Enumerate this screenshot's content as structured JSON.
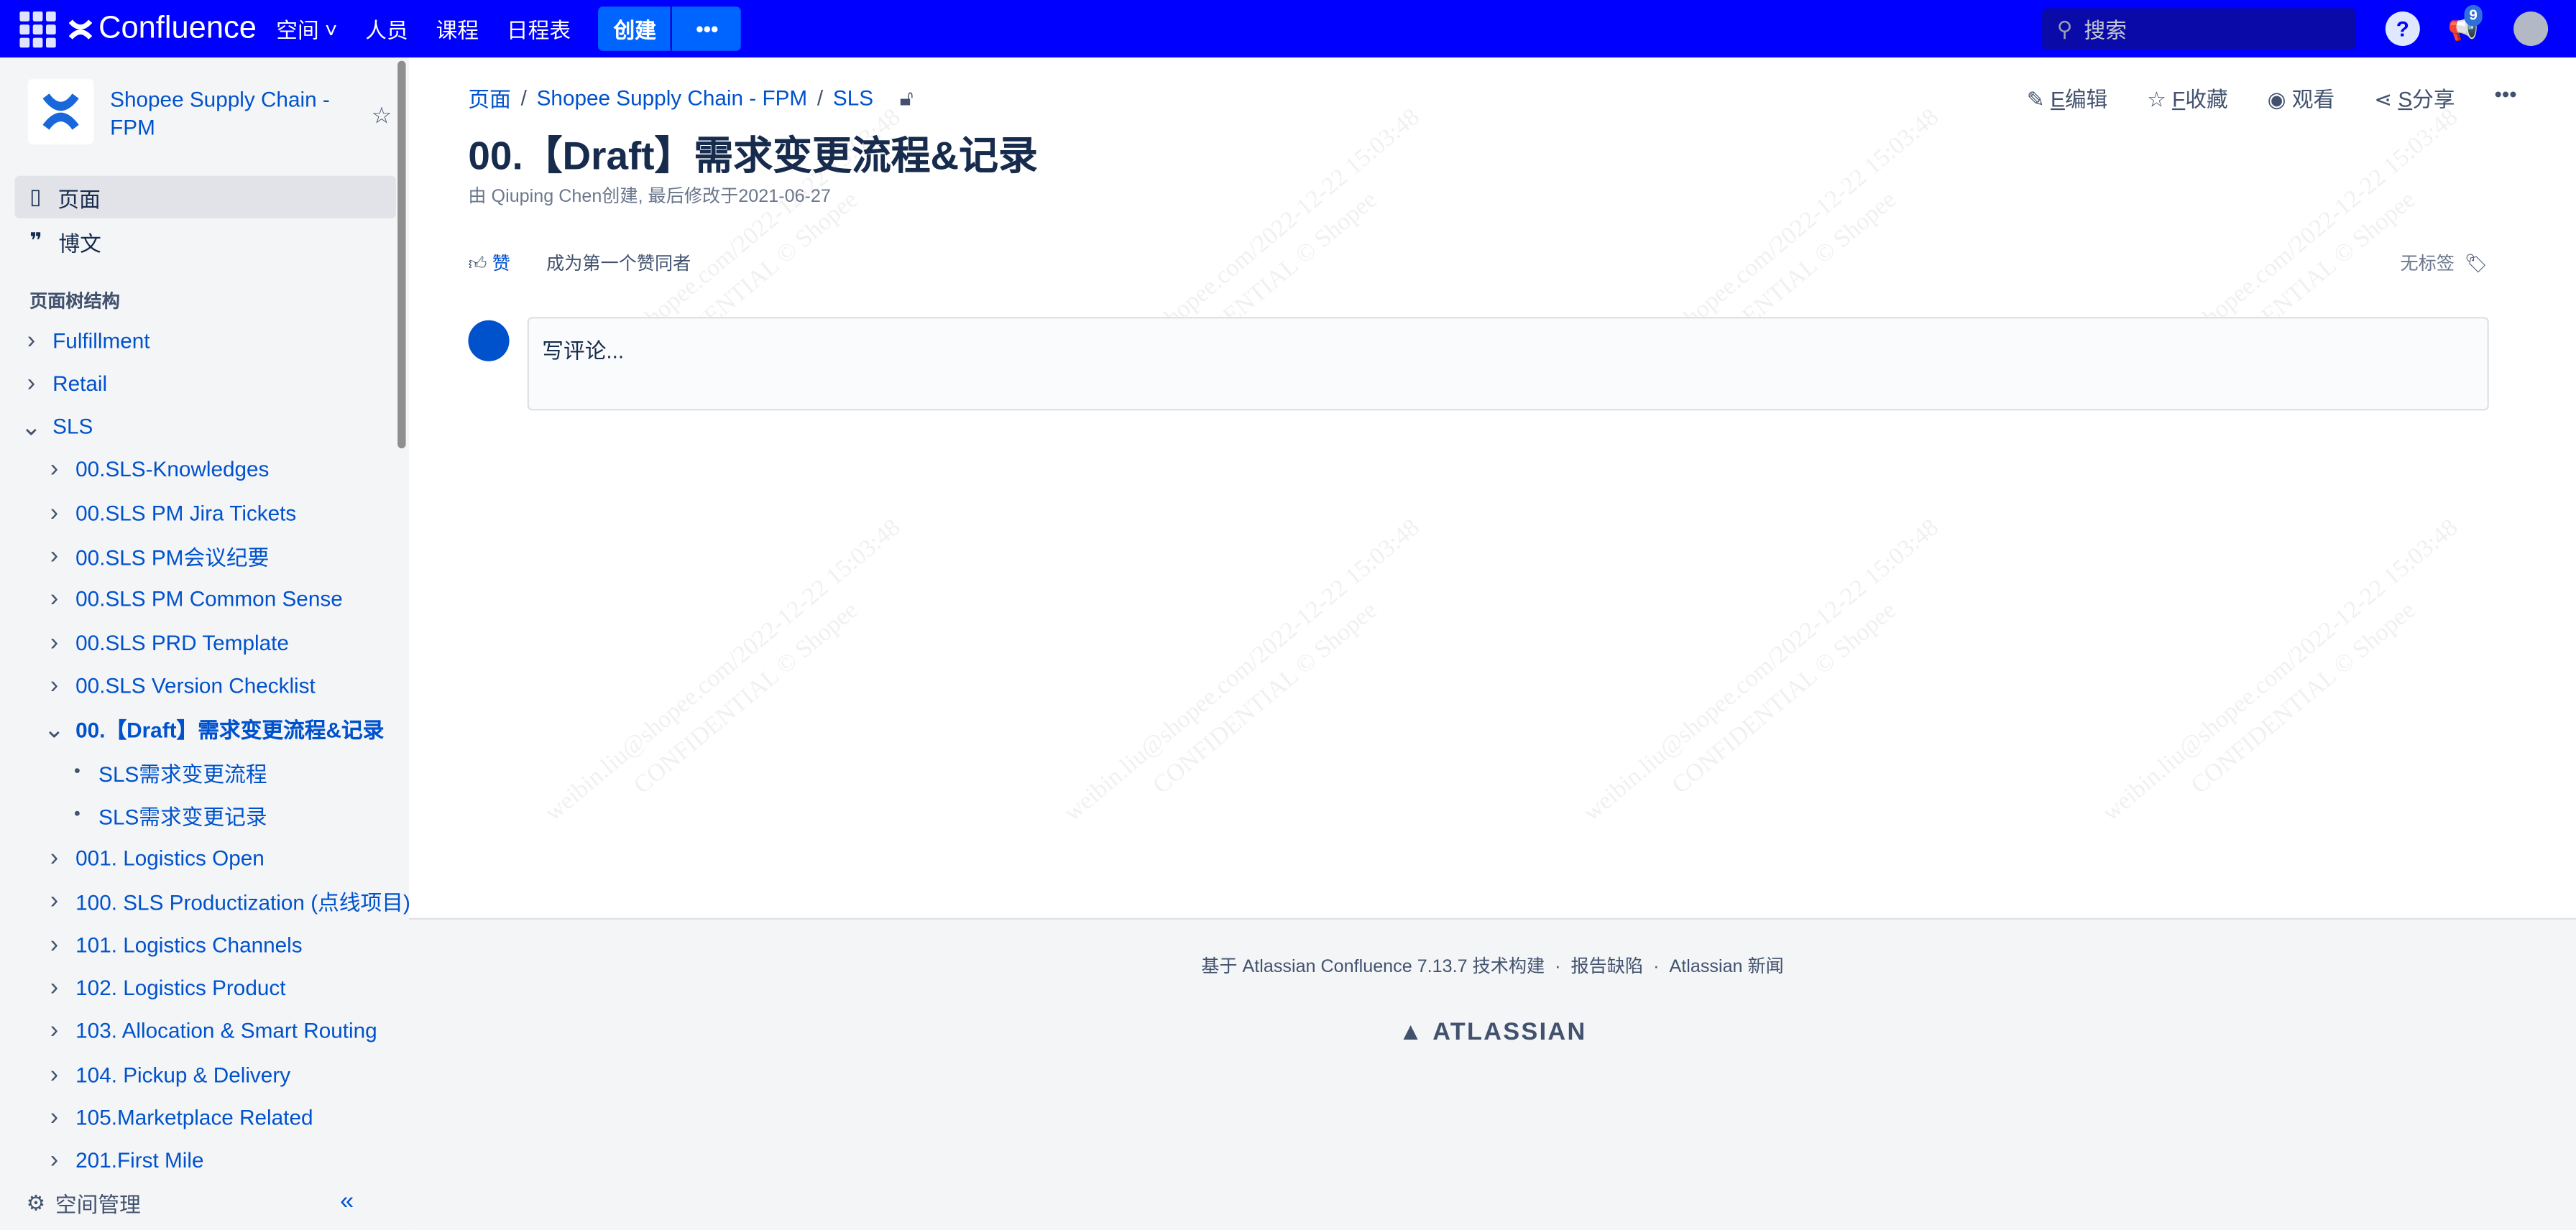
{
  "topbar": {
    "brand": "Confluence",
    "nav": [
      "空间",
      "人员",
      "课程",
      "日程表"
    ],
    "create": "创建",
    "more": "•••",
    "search_placeholder": "搜索",
    "notification_count": "9"
  },
  "sidebar": {
    "space_name": "Shopee Supply Chain - FPM",
    "pages": "页面",
    "blog": "博文",
    "tree_heading": "页面树结构",
    "tree": [
      {
        "label": "Fulfillment",
        "level": 0,
        "state": "collapsed"
      },
      {
        "label": "Retail",
        "level": 0,
        "state": "collapsed"
      },
      {
        "label": "SLS",
        "level": 0,
        "state": "expanded"
      },
      {
        "label": "00.SLS-Knowledges",
        "level": 1,
        "state": "collapsed"
      },
      {
        "label": "00.SLS PM Jira Tickets",
        "level": 1,
        "state": "collapsed"
      },
      {
        "label": "00.SLS PM会议纪要",
        "level": 1,
        "state": "collapsed"
      },
      {
        "label": "00.SLS PM Common Sense",
        "level": 1,
        "state": "collapsed"
      },
      {
        "label": "00.SLS PRD Template",
        "level": 1,
        "state": "collapsed"
      },
      {
        "label": "00.SLS Version Checklist",
        "level": 1,
        "state": "collapsed"
      },
      {
        "label": "00.【Draft】需求变更流程&记录",
        "level": 1,
        "state": "expanded",
        "current": true
      },
      {
        "label": "SLS需求变更流程",
        "level": 2,
        "state": "leaf"
      },
      {
        "label": "SLS需求变更记录",
        "level": 2,
        "state": "leaf"
      },
      {
        "label": "001. Logistics Open",
        "level": 1,
        "state": "collapsed"
      },
      {
        "label": "100. SLS Productization (点线项目)",
        "level": 1,
        "state": "collapsed"
      },
      {
        "label": "101. Logistics Channels",
        "level": 1,
        "state": "collapsed"
      },
      {
        "label": "102. Logistics Product",
        "level": 1,
        "state": "collapsed"
      },
      {
        "label": "103. Allocation & Smart Routing",
        "level": 1,
        "state": "collapsed"
      },
      {
        "label": "104. Pickup & Delivery",
        "level": 1,
        "state": "collapsed"
      },
      {
        "label": "105.Marketplace Related",
        "level": 1,
        "state": "collapsed"
      },
      {
        "label": "201.First Mile",
        "level": 1,
        "state": "collapsed"
      }
    ],
    "space_tools": "空间管理"
  },
  "page": {
    "breadcrumb": [
      "页面",
      "Shopee Supply Chain - FPM",
      "SLS"
    ],
    "actions": {
      "edit_key": "E",
      "edit": "编辑",
      "fav_key": "F",
      "fav": "收藏",
      "watch": "观看",
      "share_key": "S",
      "share": "分享"
    },
    "title": "00.【Draft】需求变更流程&记录",
    "meta": "由 Qiuping Chen创建, 最后修改于2021-06-27",
    "like": "赞",
    "like_first": "成为第一个赞同者",
    "no_labels": "无标签",
    "comment_placeholder": "写评论..."
  },
  "watermark": {
    "line1": "weibin.liu@shopee.com/2022-12-22 15:03:48",
    "line2": "CONFIDENTIAL © Shopee"
  },
  "footer": {
    "built": "基于 Atlassian Confluence 7.13.7 技术构建",
    "sep": "·",
    "report": "报告缺陷",
    "news": "Atlassian 新闻",
    "logo": "ATLASSIAN"
  }
}
